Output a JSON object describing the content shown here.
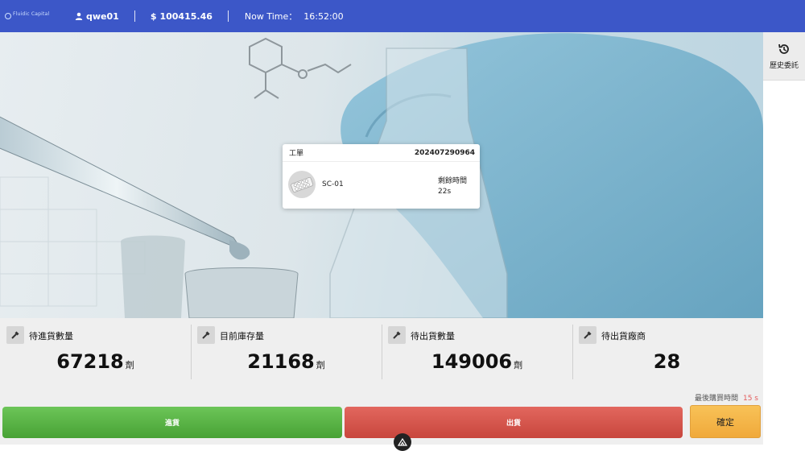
{
  "topbar": {
    "logo_text": "Fluidic Capital",
    "username": "qwe01",
    "balance": "100415.46",
    "now_time_label": "Now Time：",
    "now_time_value": "16:52:00"
  },
  "sidebar": {
    "history_label": "歷史委託"
  },
  "work_order": {
    "label": "工單",
    "id": "202407290964",
    "product": "SC-01",
    "remaining_label": "剩餘時間",
    "remaining_value": "22s"
  },
  "stats": [
    {
      "label": "待進貨數量",
      "value": "67218",
      "unit": "劑"
    },
    {
      "label": "目前庫存量",
      "value": "21168",
      "unit": "劑"
    },
    {
      "label": "待出貨數量",
      "value": "149006",
      "unit": "劑"
    },
    {
      "label": "待出貨廠商",
      "value": "28",
      "unit": ""
    }
  ],
  "last_buy": {
    "label": "最後購買時間",
    "seconds": "15 s"
  },
  "actions": {
    "stock_in_label": "進貨",
    "stock_out_label": "出貨",
    "confirm_label": "確定"
  },
  "icons": [
    "user-icon",
    "history-icon",
    "pipette-icon",
    "pill-blister-icon",
    "logo-icon"
  ],
  "colors": {
    "topbar": "#3c57c8",
    "stock_in": "#55ad40",
    "stock_out": "#d4534a",
    "confirm": "#f4b548",
    "accent_red": "#e35b5b"
  }
}
